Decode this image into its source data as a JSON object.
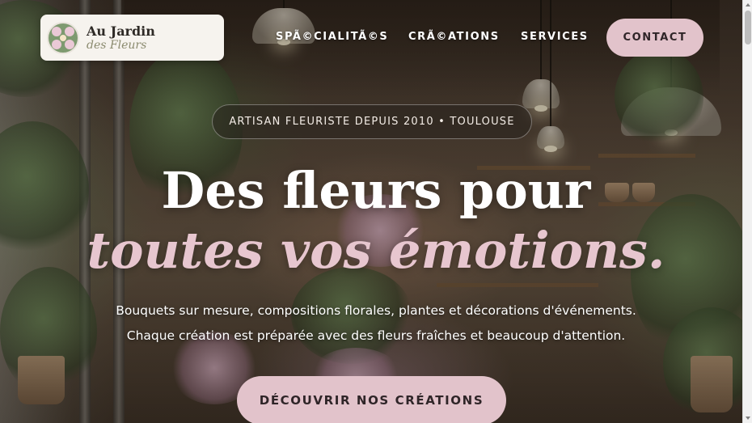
{
  "brand": {
    "title": "Au Jardin",
    "subtitle": "des Fleurs",
    "logo_icon": "flower-logo-icon"
  },
  "nav": {
    "items": [
      {
        "label": "SPÃ©CIALITÃ©S"
      },
      {
        "label": "CRÃ©ATIONS"
      },
      {
        "label": "SERVICES"
      }
    ],
    "contact_label": "CONTACT"
  },
  "hero": {
    "badge": "ARTISAN FLEURISTE DEPUIS 2010 • TOULOUSE",
    "title_line1": "Des fleurs pour",
    "title_line2": "toutes vos émotions.",
    "text_line1": "Bouquets sur mesure, compositions florales, plantes et décorations d'événements.",
    "text_line2": "Chaque création est préparée avec des fleurs fraîches et beaucoup d'attention.",
    "cta_label": "DÉCOUVRIR NOS CRÉATIONS"
  },
  "colors": {
    "accent_pink": "#e2c3cb",
    "title_pink": "#e7c6cf",
    "logo_card": "#f6f3ee",
    "logo_green": "#7e9a70",
    "text_dark": "#2f2528"
  },
  "scrollbar": {
    "position_fraction": 0.0
  }
}
